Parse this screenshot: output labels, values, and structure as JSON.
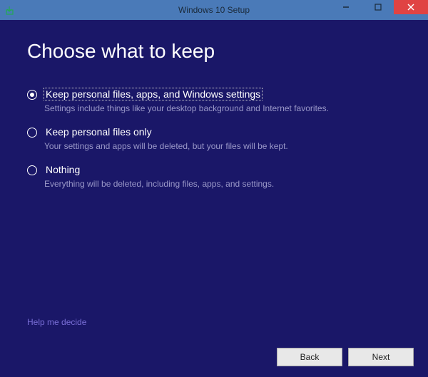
{
  "titlebar": {
    "title": "Windows 10 Setup"
  },
  "content": {
    "heading": "Choose what to keep",
    "options": [
      {
        "label": "Keep personal files, apps, and Windows settings",
        "description": "Settings include things like your desktop background and Internet favorites.",
        "selected": true
      },
      {
        "label": "Keep personal files only",
        "description": "Your settings and apps will be deleted, but your files will be kept.",
        "selected": false
      },
      {
        "label": "Nothing",
        "description": "Everything will be deleted, including files, apps, and settings.",
        "selected": false
      }
    ],
    "help_link": "Help me decide"
  },
  "footer": {
    "back_label": "Back",
    "next_label": "Next"
  }
}
